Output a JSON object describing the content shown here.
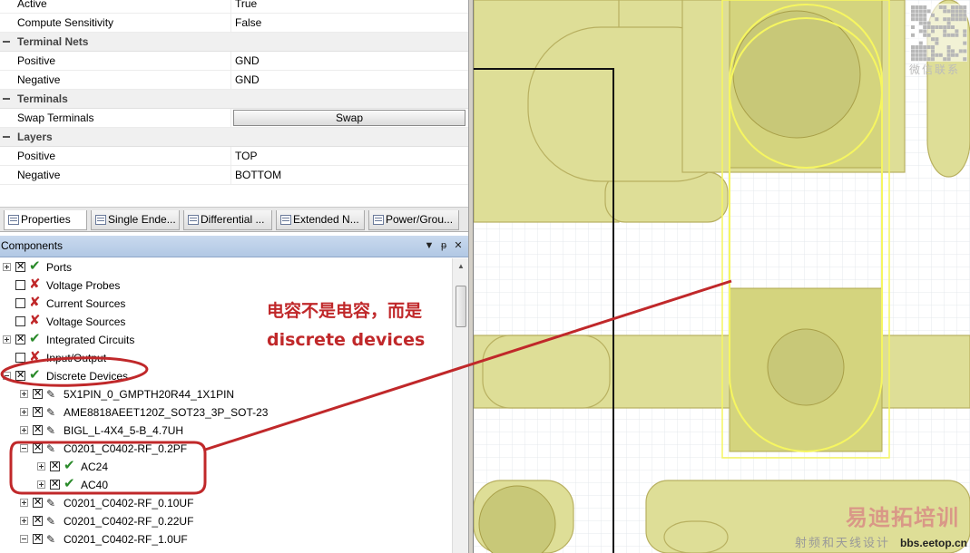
{
  "properties": {
    "rows": [
      {
        "type": "prop",
        "name": "Active",
        "value": "True"
      },
      {
        "type": "prop",
        "name": "Compute Sensitivity",
        "value": "False"
      },
      {
        "type": "cat",
        "name": "Terminal Nets"
      },
      {
        "type": "prop",
        "name": "Positive",
        "value": "GND"
      },
      {
        "type": "prop",
        "name": "Negative",
        "value": "GND"
      },
      {
        "type": "cat",
        "name": "Terminals"
      },
      {
        "type": "button",
        "name": "Swap Terminals",
        "value": "Swap"
      },
      {
        "type": "cat",
        "name": "Layers"
      },
      {
        "type": "prop",
        "name": "Positive",
        "value": "TOP"
      },
      {
        "type": "prop",
        "name": "Negative",
        "value": "BOTTOM"
      }
    ]
  },
  "tabs": [
    {
      "label": "Properties",
      "icon": "properties-icon",
      "active": true
    },
    {
      "label": "Single Ende...",
      "icon": "table-icon"
    },
    {
      "label": "Differential ...",
      "icon": "table-icon"
    },
    {
      "label": "Extended N...",
      "icon": "table-icon"
    },
    {
      "label": "Power/Grou...",
      "icon": "table-icon"
    }
  ],
  "components": {
    "title": "Components",
    "tree": [
      {
        "label": "Ports",
        "level": 0,
        "expander": "plus",
        "checked": true,
        "status": "ok"
      },
      {
        "label": "Voltage Probes",
        "level": 0,
        "expander": "none",
        "checked": false,
        "status": "bad"
      },
      {
        "label": "Current Sources",
        "level": 0,
        "expander": "none",
        "checked": false,
        "status": "bad"
      },
      {
        "label": "Voltage Sources",
        "level": 0,
        "expander": "none",
        "checked": false,
        "status": "bad"
      },
      {
        "label": "Integrated Circuits",
        "level": 0,
        "expander": "plus",
        "checked": true,
        "status": "ok"
      },
      {
        "label": "Input/Output",
        "level": 0,
        "expander": "none",
        "checked": false,
        "status": "bad"
      },
      {
        "label": "Discrete Devices",
        "level": 0,
        "expander": "minus",
        "checked": true,
        "status": "ok"
      },
      {
        "label": "5X1PIN_0_GMPTH20R44_1X1PIN",
        "level": 1,
        "expander": "plus",
        "checked": true,
        "status": "pen"
      },
      {
        "label": "AME8818AEET120Z_SOT23_3P_SOT-23",
        "level": 1,
        "expander": "plus",
        "checked": true,
        "status": "pen"
      },
      {
        "label": "BIGL_L-4X4_5-B_4.7UH",
        "level": 1,
        "expander": "plus",
        "checked": true,
        "status": "pen"
      },
      {
        "label": "C0201_C0402-RF_0.2PF",
        "level": 1,
        "expander": "minus",
        "checked": true,
        "status": "pen"
      },
      {
        "label": "AC24",
        "level": 2,
        "expander": "plus",
        "checked": true,
        "status": "ok"
      },
      {
        "label": "AC40",
        "level": 2,
        "expander": "plus",
        "checked": true,
        "status": "ok"
      },
      {
        "label": "C0201_C0402-RF_0.10UF",
        "level": 1,
        "expander": "plus",
        "checked": true,
        "status": "pen"
      },
      {
        "label": "C0201_C0402-RF_0.22UF",
        "level": 1,
        "expander": "plus",
        "checked": true,
        "status": "pen"
      },
      {
        "label": "C0201_C0402-RF_1.0UF",
        "level": 1,
        "expander": "minus",
        "checked": true,
        "status": "pen"
      }
    ]
  },
  "annotation": {
    "line1": "电容不是电容，而是",
    "line2": "discrete devices",
    "color": "#c0282a"
  },
  "watermark": {
    "qr_label": "微信联系",
    "brand": "易迪拓培训",
    "sub": "射频和天线设计",
    "url": "bbs.eetop.cn"
  },
  "colors": {
    "pcb_fill": "#dede97",
    "pcb_stroke": "#b8b060",
    "highlight": "#f6f660",
    "annotation": "#c0282a"
  }
}
